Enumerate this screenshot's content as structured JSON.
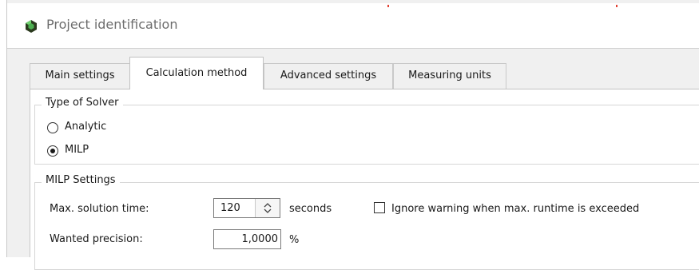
{
  "window": {
    "title": "Project identification"
  },
  "tabs": [
    {
      "label": "Main settings",
      "active": false
    },
    {
      "label": "Calculation method",
      "active": true
    },
    {
      "label": "Advanced settings",
      "active": false
    },
    {
      "label": "Measuring units",
      "active": false
    }
  ],
  "solver_group": {
    "title": "Type of Solver",
    "options": [
      {
        "label": "Analytic",
        "selected": false
      },
      {
        "label": "MILP",
        "selected": true
      }
    ]
  },
  "milp_group": {
    "title": "MILP Settings",
    "max_solution_time": {
      "label": "Max. solution time:",
      "value": "120",
      "unit": "seconds"
    },
    "ignore_warning": {
      "label": "Ignore warning when max. runtime is exceeded",
      "checked": false
    },
    "wanted_precision": {
      "label": "Wanted precision:",
      "value": "1,0000",
      "unit": "%"
    }
  },
  "colors": {
    "accent_marks": "#e34234",
    "icon_dark": "#2b3a1e",
    "icon_green": "#4caf50"
  }
}
